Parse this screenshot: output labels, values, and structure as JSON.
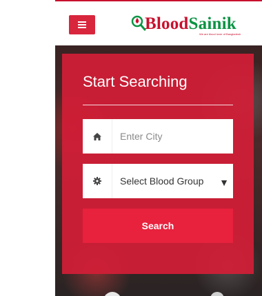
{
  "header": {
    "logo_blood": "Blood",
    "logo_sainik": "Sainik",
    "tagline": "We are blood lover of Bangladesh"
  },
  "search_card": {
    "title": "Start Searching",
    "city_placeholder": "Enter City",
    "blood_group_selected": "Select Blood Group",
    "caret": "▼",
    "search_label": "Search"
  },
  "colors": {
    "primary_red": "#d21e37",
    "button_red": "#e8213d",
    "logo_red": "#c8102e",
    "logo_green": "#0b9444"
  },
  "icons": {
    "menu": "hamburger-icon",
    "city": "home-icon",
    "group": "gear-icon",
    "logo": "magnifier-drop-icon"
  }
}
